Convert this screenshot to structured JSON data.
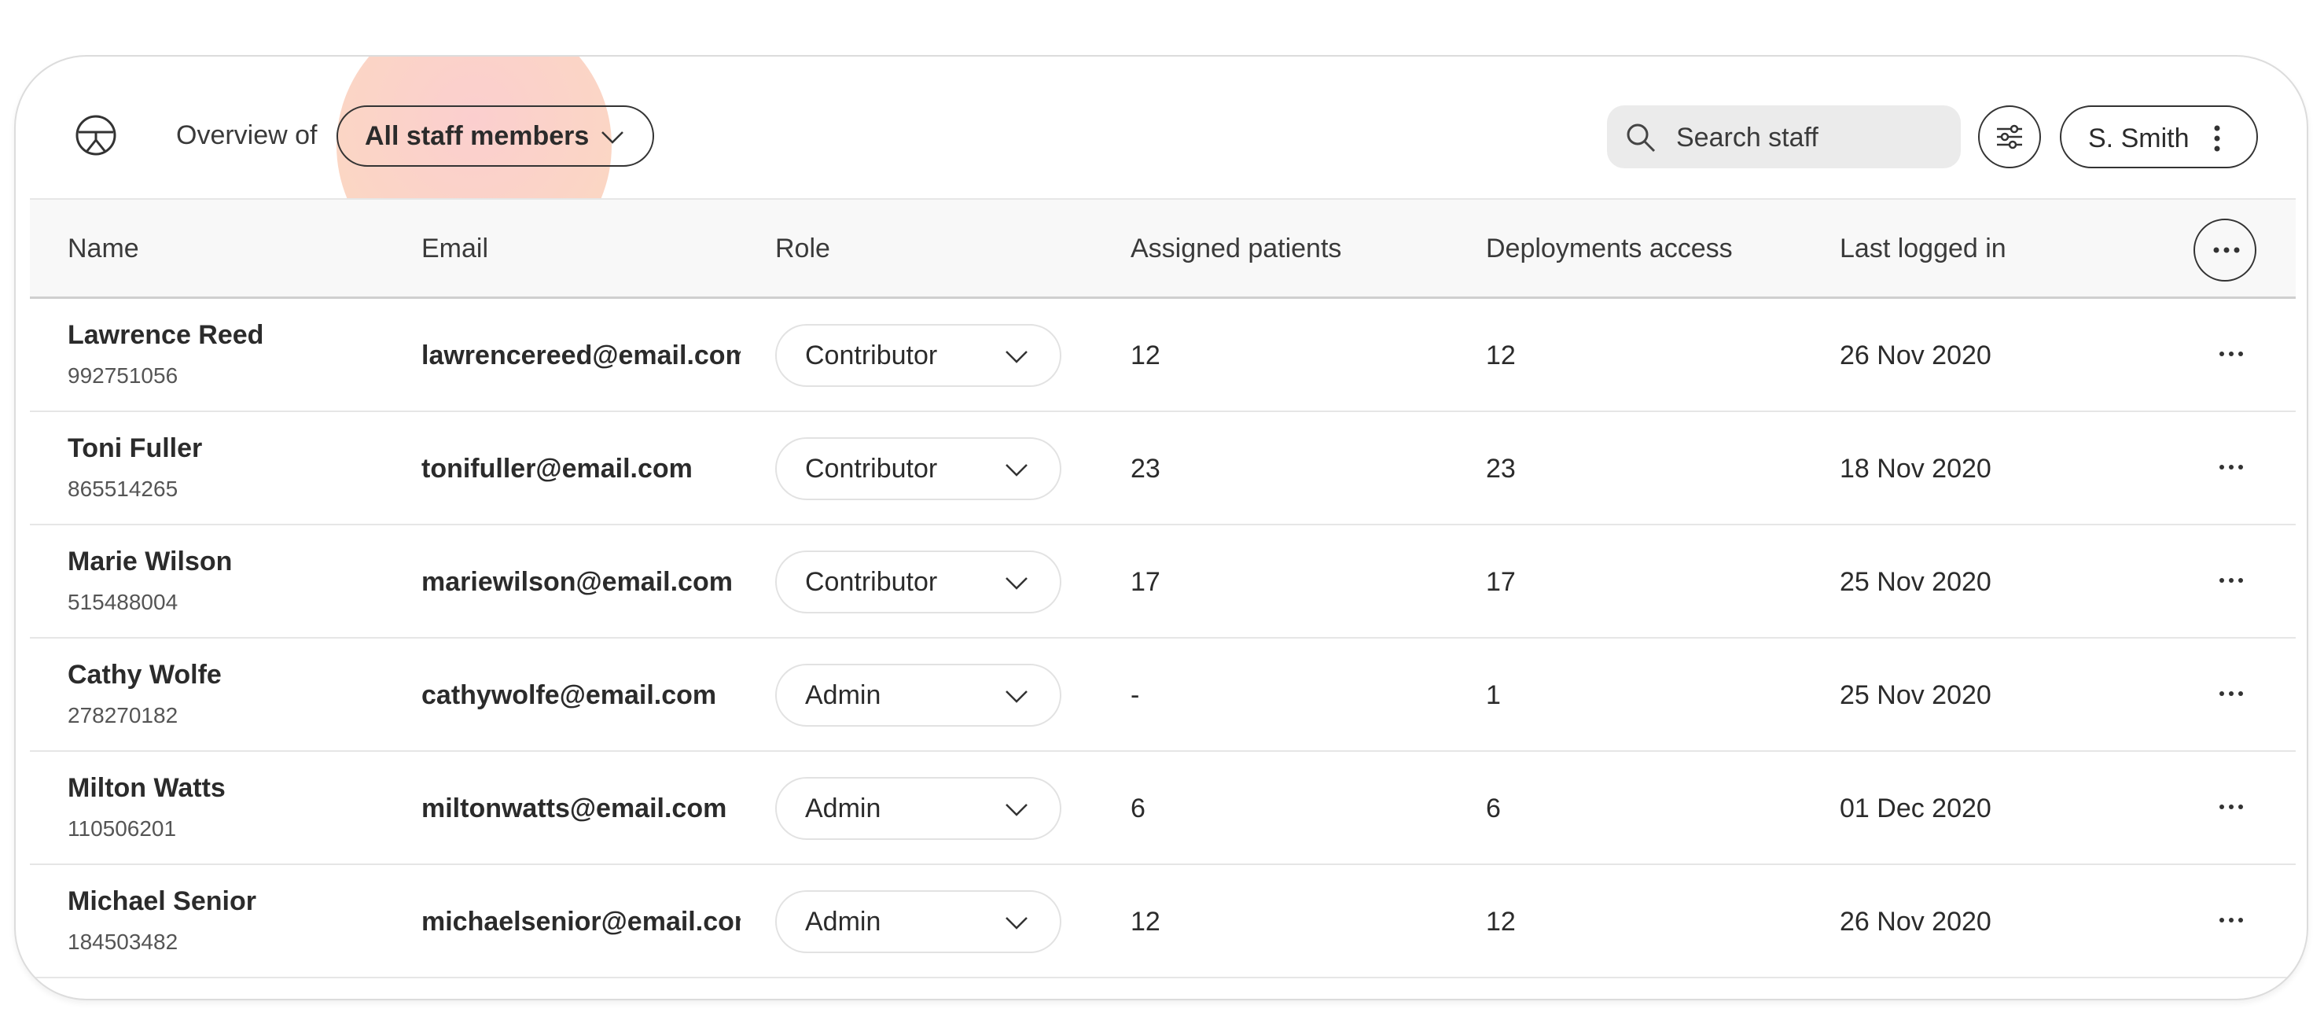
{
  "header": {
    "overview_label": "Overview of",
    "staff_filter": "All staff members",
    "search_placeholder": "Search staff",
    "user_name": "S. Smith"
  },
  "table": {
    "columns": [
      "Name",
      "Email",
      "Role",
      "Assigned patients",
      "Deployments access",
      "Last logged in"
    ],
    "rows": [
      {
        "name": "Lawrence Reed",
        "id": "992751056",
        "email": "lawrencereed@email.com",
        "role": "Contributor",
        "assigned": "12",
        "deployments": "12",
        "last_login": "26 Nov 2020"
      },
      {
        "name": "Toni Fuller",
        "id": "865514265",
        "email": "tonifuller@email.com",
        "role": "Contributor",
        "assigned": "23",
        "deployments": "23",
        "last_login": "18 Nov 2020"
      },
      {
        "name": "Marie Wilson",
        "id": "515488004",
        "email": "mariewilson@email.com",
        "role": "Contributor",
        "assigned": "17",
        "deployments": "17",
        "last_login": "25 Nov 2020"
      },
      {
        "name": "Cathy Wolfe",
        "id": "278270182",
        "email": "cathywolfe@email.com",
        "role": "Admin",
        "assigned": "-",
        "deployments": "1",
        "last_login": "25 Nov 2020"
      },
      {
        "name": "Milton Watts",
        "id": "110506201",
        "email": "miltonwatts@email.com",
        "role": "Admin",
        "assigned": "6",
        "deployments": "6",
        "last_login": "01 Dec 2020"
      },
      {
        "name": "Michael Senior",
        "id": "184503482",
        "email": "michaelsenior@email.com",
        "role": "Admin",
        "assigned": "12",
        "deployments": "12",
        "last_login": "26 Nov 2020"
      }
    ]
  },
  "icons": {
    "logo": "person-circle-logo-icon",
    "search": "search-icon",
    "filter": "sliders-icon",
    "user_menu": "vertical-dots-icon",
    "row_menu": "horizontal-dots-icon"
  },
  "colors": {
    "highlight": "#f9c4b4",
    "border_dark": "#333333",
    "search_bg": "#ebebeb"
  }
}
